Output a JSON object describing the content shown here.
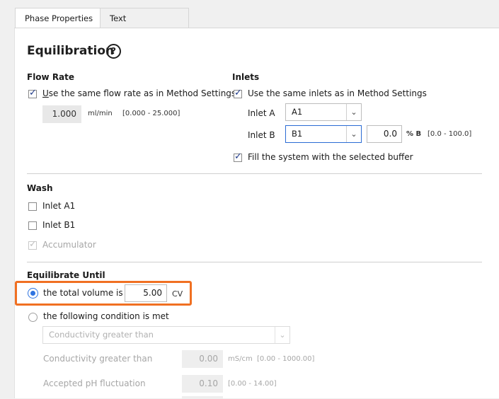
{
  "tabs": [
    {
      "label": "Phase Properties",
      "active": true
    },
    {
      "label": "Text Instructions",
      "icon": "text-instructions-icon",
      "icon_glyph": "│T"
    }
  ],
  "title": "Equilibration",
  "help_glyph": "?",
  "flow_rate": {
    "heading": "Flow Rate",
    "same_as_method": "Use the same flow rate as in Method Settings",
    "checked": true,
    "value": "1.000",
    "unit": "ml/min",
    "range": "[0.000 - 25.000]"
  },
  "inlets": {
    "heading": "Inlets",
    "same_as_method": "Use the same inlets as in Method Settings",
    "checked": true,
    "inlet_a_label": "Inlet A",
    "inlet_a_value": "A1",
    "inlet_b_label": "Inlet B",
    "inlet_b_value": "B1",
    "percent_b_value": "0.0",
    "percent_b_unit": "% B",
    "percent_b_range": "[0.0 - 100.0]",
    "fill_system": "Fill the system with the selected buffer",
    "fill_checked": true
  },
  "wash": {
    "heading": "Wash",
    "items": [
      {
        "label": "Inlet A1",
        "checked": false,
        "enabled": true
      },
      {
        "label": "Inlet B1",
        "checked": false,
        "enabled": true
      },
      {
        "label": "Accumulator",
        "checked": true,
        "enabled": false
      }
    ]
  },
  "equilibrate_until": {
    "heading": "Equilibrate Until",
    "option_volume": "the total volume is",
    "volume_value": "5.00",
    "volume_unit": "CV",
    "option_condition": "the following condition is met",
    "selected": "volume",
    "condition_select": "Conductivity greater than",
    "conductivity_label": "Conductivity greater than",
    "conductivity_value": "0.00",
    "conductivity_unit": "mS/cm",
    "conductivity_range": "[0.00 - 1000.00]",
    "ph_label": "Accepted pH fluctuation",
    "ph_value": "0.10",
    "ph_range": "[0.00 - 14.00]"
  },
  "colors": {
    "highlight": "#f07022",
    "radio_selected": "#2f74e0",
    "focus_border": "#2b6cd4"
  }
}
